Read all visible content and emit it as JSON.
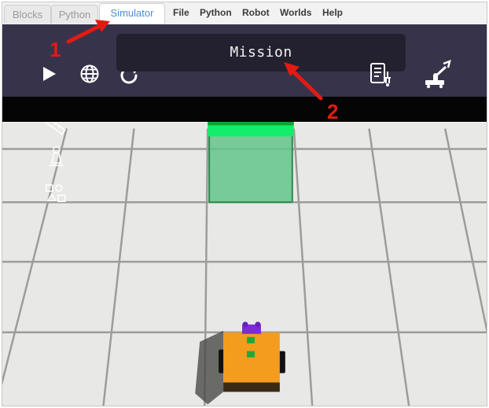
{
  "tabs": [
    {
      "label": "Blocks"
    },
    {
      "label": "Python"
    },
    {
      "label": "Simulator"
    }
  ],
  "menu": [
    {
      "label": "File"
    },
    {
      "label": "Python"
    },
    {
      "label": "Robot"
    },
    {
      "label": "Worlds"
    },
    {
      "label": "Help"
    }
  ],
  "mission": {
    "label": "Mission"
  },
  "annotations": {
    "one": "1",
    "two": "2"
  },
  "colors": {
    "accent": "#4a8ed6",
    "toolbar": "#37334a",
    "mission_box": "#232130",
    "arrow": "#e21b12",
    "goal_green": "#12ee6a",
    "robot_orange": "#f39c1e"
  }
}
